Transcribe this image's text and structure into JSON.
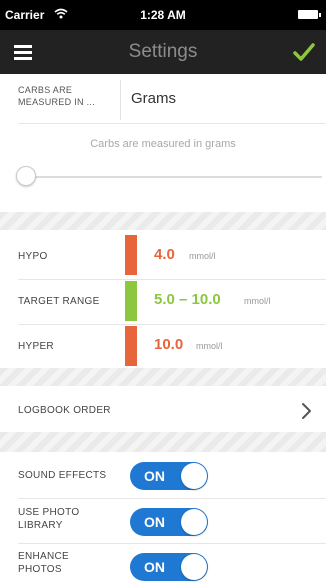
{
  "status_bar": {
    "carrier": "Carrier",
    "time": "1:28 AM"
  },
  "nav": {
    "title": "Settings",
    "menu_icon": "hamburger-menu-icon",
    "done_icon": "checkmark-icon",
    "accent_color": "#8dc63f"
  },
  "carbs": {
    "label": "CARBS ARE\nMEASURED IN ...",
    "value": "Grams",
    "note": "Carbs are measured in grams"
  },
  "ranges": {
    "hypo": {
      "label": "HYPO",
      "value": "4.0",
      "unit": "mmol/l",
      "color": "#e8653b"
    },
    "target": {
      "label": "TARGET RANGE",
      "value": "5.0 – 10.0",
      "unit": "mmol/l",
      "color": "#8dc63f"
    },
    "hyper": {
      "label": "HYPER",
      "value": "10.0",
      "unit": "mmol/l",
      "color": "#e8653b"
    }
  },
  "logbook": {
    "label": "LOGBOOK ORDER"
  },
  "toggles": {
    "sound_effects": {
      "label": "SOUND EFFECTS",
      "state": "ON"
    },
    "use_photo_library": {
      "label": "USE PHOTO\nLIBRARY",
      "state": "ON"
    },
    "enhance_photos": {
      "label": "ENHANCE\nPHOTOS",
      "state": "ON"
    }
  },
  "toggle_color": "#1f78d1"
}
